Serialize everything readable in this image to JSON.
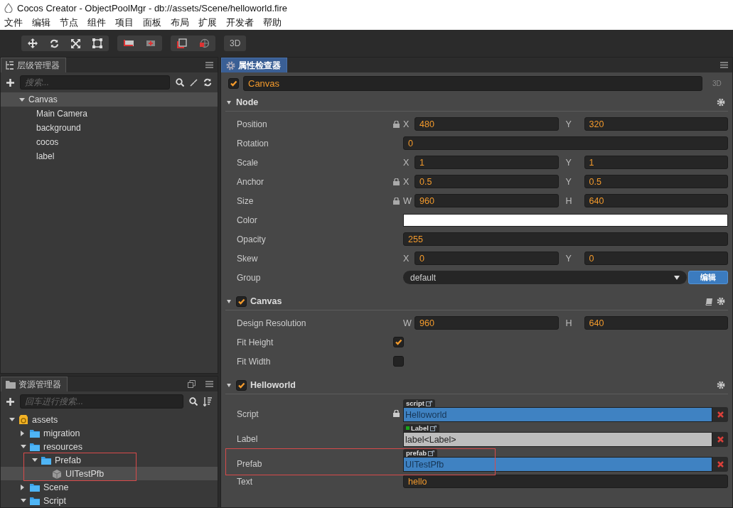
{
  "window": {
    "title": "Cocos Creator - ObjectPoolMgr - db://assets/Scene/helloworld.fire"
  },
  "menu": [
    "文件",
    "编辑",
    "节点",
    "组件",
    "项目",
    "面板",
    "布局",
    "扩展",
    "开发者",
    "帮助"
  ],
  "toolbar": {
    "mode_label": "3D"
  },
  "hierarchy": {
    "title": "层级管理器",
    "search": {
      "placeholder": "搜索..."
    },
    "tree": [
      {
        "label": "Canvas",
        "expanded": true,
        "selected": true,
        "children": [
          {
            "label": "Main Camera",
            "selected": false
          },
          {
            "label": "background",
            "selected": false
          },
          {
            "label": "cocos",
            "selected": false
          },
          {
            "label": "label",
            "selected": false
          }
        ]
      }
    ]
  },
  "assets": {
    "title": "资源管理器",
    "search": {
      "placeholder": "回车进行搜索..."
    },
    "tree": [
      {
        "label": "assets",
        "kind": "db",
        "expanded": true,
        "selected": false,
        "children": [
          {
            "label": "migration",
            "kind": "folder",
            "expanded": false,
            "selected": false
          },
          {
            "label": "resources",
            "kind": "folder",
            "expanded": true,
            "selected": false,
            "children": [
              {
                "label": "Prefab",
                "kind": "folder",
                "expanded": true,
                "selected": false,
                "highlighted": true,
                "children": [
                  {
                    "label": "UITestPfb",
                    "kind": "prefab",
                    "selected": true
                  }
                ]
              }
            ]
          },
          {
            "label": "Scene",
            "kind": "folder",
            "expanded": false,
            "selected": false
          },
          {
            "label": "Script",
            "kind": "folder",
            "expanded": true,
            "selected": false
          }
        ]
      }
    ]
  },
  "inspector": {
    "title": "属性检查器",
    "node": {
      "name": "Canvas",
      "active": true
    },
    "badge": "3D",
    "components": [
      {
        "name": "Node",
        "kind": "node",
        "properties": [
          {
            "kind": "xy",
            "label": "Position",
            "locked": true,
            "a_label": "X",
            "a": "480",
            "b_label": "Y",
            "b": "320"
          },
          {
            "kind": "single",
            "label": "Rotation",
            "value": "0"
          },
          {
            "kind": "xy",
            "label": "Scale",
            "a_label": "X",
            "a": "1",
            "b_label": "Y",
            "b": "1"
          },
          {
            "kind": "xy",
            "label": "Anchor",
            "locked": true,
            "a_label": "X",
            "a": "0.5",
            "b_label": "Y",
            "b": "0.5"
          },
          {
            "kind": "xy",
            "label": "Size",
            "locked": true,
            "a_label": "W",
            "a": "960",
            "b_label": "H",
            "b": "640"
          },
          {
            "kind": "color",
            "label": "Color",
            "color": "#ffffff"
          },
          {
            "kind": "single",
            "label": "Opacity",
            "value": "255"
          },
          {
            "kind": "xy",
            "label": "Skew",
            "a_label": "X",
            "a": "0",
            "b_label": "Y",
            "b": "0"
          },
          {
            "kind": "select",
            "label": "Group",
            "value": "default",
            "button": "编辑"
          }
        ]
      },
      {
        "name": "Canvas",
        "kind": "component",
        "enabled": true,
        "help": true,
        "properties": [
          {
            "kind": "xy",
            "label": "Design Resolution",
            "a_label": "W",
            "a": "960",
            "b_label": "H",
            "b": "640"
          },
          {
            "kind": "check",
            "label": "Fit Height",
            "checked": true
          },
          {
            "kind": "check",
            "label": "Fit Width",
            "checked": false
          }
        ]
      },
      {
        "name": "Helloworld",
        "kind": "component",
        "enabled": true,
        "help": false,
        "properties": [
          {
            "kind": "asset",
            "label": "Script",
            "locked": true,
            "tag": "script",
            "value": "Helloworld"
          },
          {
            "kind": "component_ref",
            "label": "Label",
            "tag": "Label",
            "value": "label<Label>",
            "color": "#19a319"
          },
          {
            "kind": "asset",
            "label": "Prefab",
            "tag": "prefab",
            "value": "UITestPfb",
            "highlighted": true
          },
          {
            "kind": "single",
            "label": "Text",
            "value": "hello"
          }
        ]
      }
    ]
  }
}
